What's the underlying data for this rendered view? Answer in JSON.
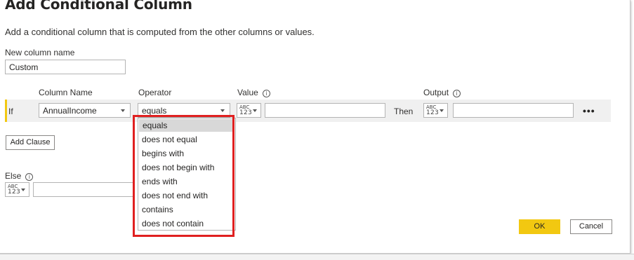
{
  "dialog": {
    "title": "Add Conditional Column",
    "description": "Add a conditional column that is computed from the other columns or values."
  },
  "new_column": {
    "label": "New column name",
    "value": "Custom"
  },
  "headers": {
    "column_name": "Column Name",
    "operator": "Operator",
    "value": "Value",
    "output": "Output"
  },
  "clause": {
    "if_label": "If",
    "column_name": "AnnualIncome",
    "operator": "equals",
    "value_type_abc": "ABC",
    "value_type_123": "123",
    "value": "",
    "then_label": "Then",
    "output_type_abc": "ABC",
    "output_type_123": "123",
    "output": "",
    "more": "•••"
  },
  "add_clause_label": "Add Clause",
  "else": {
    "label": "Else",
    "type_abc": "ABC",
    "type_123": "123",
    "value": ""
  },
  "operator_dropdown": {
    "options": [
      "equals",
      "does not equal",
      "begins with",
      "does not begin with",
      "ends with",
      "does not end with",
      "contains",
      "does not contain"
    ],
    "selected": "equals"
  },
  "buttons": {
    "ok": "OK",
    "cancel": "Cancel"
  },
  "icons": {
    "info": "i",
    "highlight_color": "#e02020",
    "accent_color": "#f2c811"
  }
}
